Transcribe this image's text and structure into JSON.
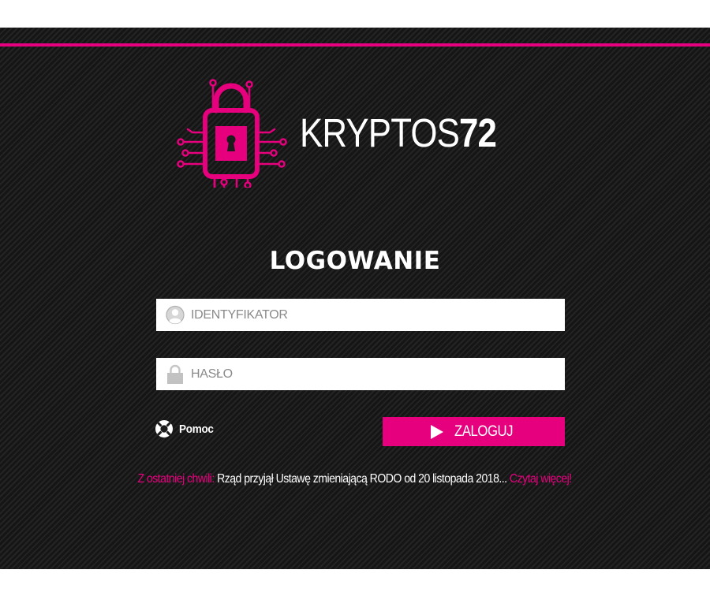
{
  "brand": {
    "name_text": "KRYPTOS",
    "name_number": "72",
    "accent_color": "#e6007e",
    "logo_icon": "lock-circuit-icon"
  },
  "login": {
    "heading": "LOGOWANIE",
    "identifier_placeholder": "IDENTYFIKATOR",
    "identifier_value": "",
    "identifier_icon": "user-icon",
    "password_placeholder": "HASŁO",
    "password_value": "",
    "password_icon": "padlock-icon",
    "help_label": "Pomoc",
    "help_icon": "lifebuoy-icon",
    "submit_label": "ZALOGUJ",
    "submit_icon": "play-icon"
  },
  "news": {
    "prefix": "Z ostatniej chwili:",
    "text": "Rząd przyjął Ustawę zmieniającą RODO od 20 listopada 2018...",
    "link_label": "Czytaj więcej!"
  }
}
